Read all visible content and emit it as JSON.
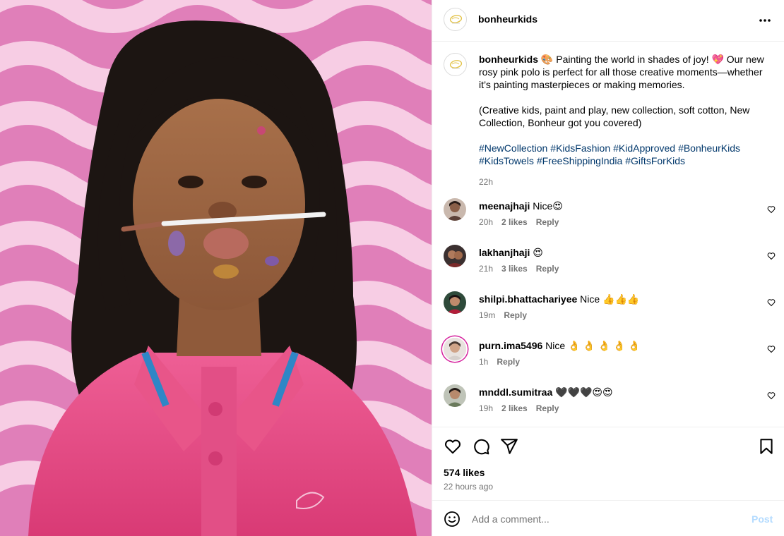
{
  "post": {
    "username": "bonheurkids",
    "image_alt": "Child in pink polo with paintbrush on upper lip",
    "caption_line1_rest": " 🎨 Painting the world in shades of joy! 💖 Our new rosy pink polo is perfect for all those creative moments—whether it’s painting masterpieces or making memories.",
    "caption_line2": "(Creative kids, paint and play, new collection, soft cotton, New Collection, Bonheur got you covered)",
    "hashtags": [
      "#NewCollection",
      "#KidsFashion",
      "#KidApproved",
      "#BonheurKids",
      "#KidsTowels",
      "#FreeShippingIndia",
      "#GiftsForKids"
    ],
    "caption_time": "22h",
    "likes": "574 likes",
    "posted_ago": "22 hours ago"
  },
  "comments": [
    {
      "user": "meenajhaji",
      "text": " Nice😍",
      "time": "20h",
      "likes": "2 likes",
      "reply": "Reply"
    },
    {
      "user": "lakhanjhaji",
      "text": " 😍",
      "time": "21h",
      "likes": "3 likes",
      "reply": "Reply"
    },
    {
      "user": "shilpi.bhattachariyee",
      "text": " Nice 👍👍👍",
      "time": "19m",
      "likes": "",
      "reply": "Reply"
    },
    {
      "user": "purn.ima5496",
      "text": " Nice 👌 👌 👌 👌 👌",
      "time": "1h",
      "likes": "",
      "reply": "Reply"
    },
    {
      "user": "mnddl.sumitraa",
      "text": " 🖤🖤🖤😍😍",
      "time": "19h",
      "likes": "2 likes",
      "reply": "Reply"
    }
  ],
  "composer": {
    "placeholder": "Add a comment...",
    "post_label": "Post"
  },
  "icons": {
    "more": "more-horizontal-icon",
    "like": "heart-icon",
    "comment": "comment-bubble-icon",
    "share": "paper-plane-icon",
    "save": "bookmark-icon",
    "emoji": "smiley-icon"
  },
  "colors": {
    "background_pink": "#e07fb9",
    "wave_light": "#f7cde4",
    "polo_pink": "#e4467f",
    "collar_stripe": "#2f86c6",
    "hashtag": "#00376b",
    "muted_text": "#737373",
    "post_disabled": "#b3dbff"
  }
}
